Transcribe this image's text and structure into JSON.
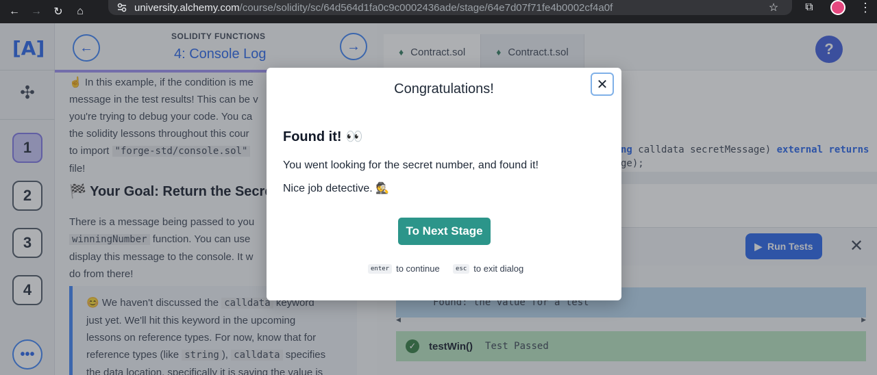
{
  "browser": {
    "url_host": "university.alchemy.com",
    "url_path": "/course/solidity/sc/64d564d1fa0c9c0002436ade/stage/64e7d07f71fe4b0002cf4a0f",
    "icons": [
      "back-arrow-icon",
      "forward-arrow-icon",
      "reload-icon",
      "home-icon",
      "site-settings-icon",
      "bookmark-star-icon",
      "extensions-icon",
      "profile-avatar",
      "kebab-menu-icon"
    ]
  },
  "sidebar": {
    "logo": "[A]",
    "steps": [
      "1",
      "2",
      "3",
      "4"
    ],
    "active_step": "1",
    "more": "•••"
  },
  "lesson": {
    "kicker": "SOLIDITY FUNCTIONS",
    "title": "4: Console Log",
    "prev_icon": "←",
    "next_icon": "→",
    "p1_emoji": "☝️",
    "p1_a": "In this example, if the condition is me",
    "p1_b": "message in the test results! This can be v",
    "p1_c": "you're trying to debug your code. You ca",
    "p1_d": "the solidity lessons throughout this cour",
    "p1_e_pre": "to import",
    "p1_e_code": "\"forge-std/console.sol\"",
    "p1_f": "file!",
    "goal_emoji": "🏁",
    "goal": "Your Goal: Return the Secre",
    "p2_a": "There is a message being passed to you",
    "p2_b_code": "winningNumber",
    "p2_b_post": "function. You can use",
    "p2_c": "display this message to the console. It w",
    "p2_d": "do from there!",
    "note_emoji": "😊",
    "note_a_pre": "We haven't discussed the",
    "note_a_code": "calldata",
    "note_a_post": "keyword",
    "note_b": "just yet. We'll hit this keyword in the upcoming",
    "note_c": "lessons on reference types. For now, know that for",
    "note_d_pre": "reference types (like",
    "note_d_code1": "string",
    "note_d_mid": "),",
    "note_d_code2": "calldata",
    "note_d_post": "specifies",
    "note_e": "the data location, specifically it is saving the value is"
  },
  "editor": {
    "tabs": [
      "Contract.sol",
      "Contract.t.sol"
    ],
    "active_tab": "Contract.sol",
    "help": "?",
    "code_a_kw": "ng",
    "code_a_text": "calldata secretMessage)",
    "code_a_kw2": "external returns",
    "code_b": "ge);"
  },
  "tests": {
    "run_label": "Run Tests",
    "close": "✕",
    "blue_text": "Found: the value for a test",
    "green_name": "testWin()",
    "green_status": "Test Passed"
  },
  "modal": {
    "title": "Congratulations!",
    "heading": "Found it!",
    "heading_emoji": "👀",
    "text1": "You went looking for the secret number, and found it!",
    "text2": "Nice job detective.",
    "text2_emoji": "🕵",
    "button": "To Next Stage",
    "hint1_key": "enter",
    "hint1_text": "to continue",
    "hint2_key": "esc",
    "hint2_text": "to exit dialog",
    "close": "✕"
  }
}
